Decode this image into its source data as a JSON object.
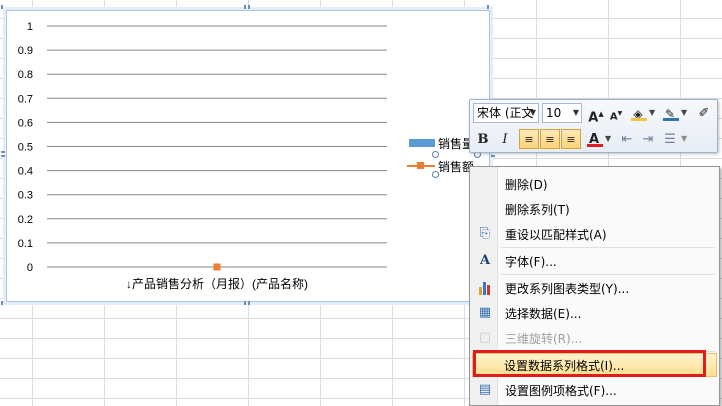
{
  "chart_data": {
    "type": "line",
    "categories": [
      "产品销售分析（月报）(产品名称)"
    ],
    "category_prefix_icon": "down-arrow-icon",
    "y_ticks": [
      "0",
      "0.1",
      "0.2",
      "0.3",
      "0.4",
      "0.5",
      "0.6",
      "0.7",
      "0.8",
      "0.9",
      "1"
    ],
    "ylim": [
      0,
      1
    ],
    "grid": true,
    "series": [
      {
        "name": "销售量",
        "values": [
          0
        ],
        "color": "#5b9bd5",
        "marker": "none"
      },
      {
        "name": "销售额",
        "values": [
          0
        ],
        "color": "#ed7d31",
        "marker": "square"
      }
    ],
    "legend_position": "right"
  },
  "legend": {
    "item1": "销售量",
    "item2": "销售额"
  },
  "mini_toolbar": {
    "font_name": "宋体 (正文",
    "font_size": "10",
    "grow_font": "A",
    "shrink_font": "A",
    "bold": "B",
    "italic": "I",
    "font_color": "A",
    "font_color_bar": "#e01c1c",
    "highlight_color": "#f5c542"
  },
  "context_menu": {
    "items": [
      {
        "label": "删除(D)",
        "icon": "",
        "enabled": true
      },
      {
        "label": "删除系列(T)",
        "icon": "",
        "enabled": true
      },
      {
        "label": "重设以匹配样式(A)",
        "icon": "reset-style-icon",
        "enabled": true
      },
      {
        "label": "字体(F)...",
        "icon": "font-icon",
        "enabled": true
      },
      {
        "label": "更改系列图表类型(Y)...",
        "icon": "chart-type-icon",
        "enabled": true
      },
      {
        "label": "选择数据(E)...",
        "icon": "select-data-icon",
        "enabled": true
      },
      {
        "label": "三维旋转(R)...",
        "icon": "3d-rotation-icon",
        "enabled": false
      },
      {
        "label": "设置数据系列格式(I)...",
        "icon": "",
        "enabled": true,
        "highlighted": true
      },
      {
        "label": "设置图例项格式(F)...",
        "icon": "format-legend-icon",
        "enabled": true
      }
    ]
  },
  "colors": {
    "highlight_box": "#e01c1c",
    "menu_highlight": "#fde08d"
  }
}
